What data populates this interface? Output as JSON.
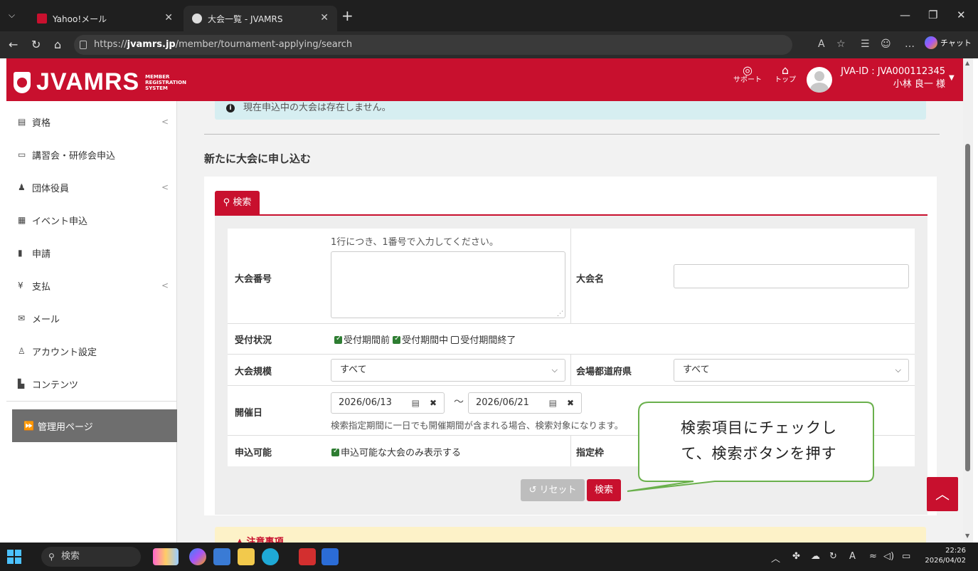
{
  "browser": {
    "tabs": [
      {
        "label": "Yahoo!メール"
      },
      {
        "label": "大会一覧 - JVAMRS"
      }
    ],
    "url_prefix": "https://",
    "url_host": "jvamrs.jp",
    "url_path": "/member/tournament-applying/search",
    "chat_label": "チャット",
    "read_aloud": "Á"
  },
  "header": {
    "logo_text": "JVAMRS",
    "logo_sub": [
      "MEMBER",
      "REGISTRATION",
      "SYSTEM"
    ],
    "support_label": "サポート",
    "top_label": "トップ",
    "user_id": "JVA-ID : JVA000112345",
    "user_name": "小林 良一 様"
  },
  "sidebar": {
    "items": [
      {
        "label": "資格",
        "icon": "certificate-icon",
        "chevron": "<"
      },
      {
        "label": "講習会・研修会申込",
        "icon": "seminar-icon",
        "chevron": ""
      },
      {
        "label": "団体役員",
        "icon": "officers-icon",
        "chevron": "<"
      },
      {
        "label": "イベント申込",
        "icon": "calendar-icon",
        "chevron": ""
      },
      {
        "label": "申請",
        "icon": "document-icon",
        "chevron": ""
      },
      {
        "label": "支払",
        "icon": "yen-icon",
        "chevron": "<"
      },
      {
        "label": "メール",
        "icon": "mail-icon",
        "chevron": ""
      },
      {
        "label": "アカウント設定",
        "icon": "user-gear-icon",
        "chevron": ""
      },
      {
        "label": "コンテンツ",
        "icon": "file-icon",
        "chevron": ""
      }
    ],
    "admin_label": "管理用ページ"
  },
  "main": {
    "info_alert": "現在申込中の大会は存在しません。",
    "section_title": "新たに大会に申し込む",
    "search_tab": "検索",
    "form": {
      "number_hint": "1行につき、1番号で入力してください。",
      "number_label": "大会番号",
      "name_label": "大会名",
      "status_label": "受付状況",
      "status_options": [
        {
          "label": "受付期間前",
          "checked": true
        },
        {
          "label": "受付期間中",
          "checked": true
        },
        {
          "label": "受付期間終了",
          "checked": false
        }
      ],
      "scale_label": "大会規模",
      "scale_value": "すべて",
      "pref_label": "会場都道府県",
      "pref_value": "すべて",
      "date_label": "開催日",
      "date_from": "2026/06/13",
      "date_to": "2026/06/21",
      "date_sep": "～",
      "date_note": "検索指定期間に一日でも開催期間が含まれる場合、検索対象になります。",
      "apply_label": "申込可能",
      "apply_option": "申込可能な大会のみ表示する",
      "apply_checked": true,
      "quota_label": "指定枠"
    },
    "reset_button": "リセット",
    "search_button": "検索",
    "warning_title": "注意事項"
  },
  "callout": {
    "line1": "検索項目にチェックし",
    "line2": "て、検索ボタンを押す"
  },
  "taskbar": {
    "search_label": "検索",
    "time": "22:26",
    "date": "2026/04/02"
  },
  "colors": {
    "brand": "#c8102e",
    "callout_border": "#6ab04c",
    "info_bg": "#d6eef1"
  }
}
